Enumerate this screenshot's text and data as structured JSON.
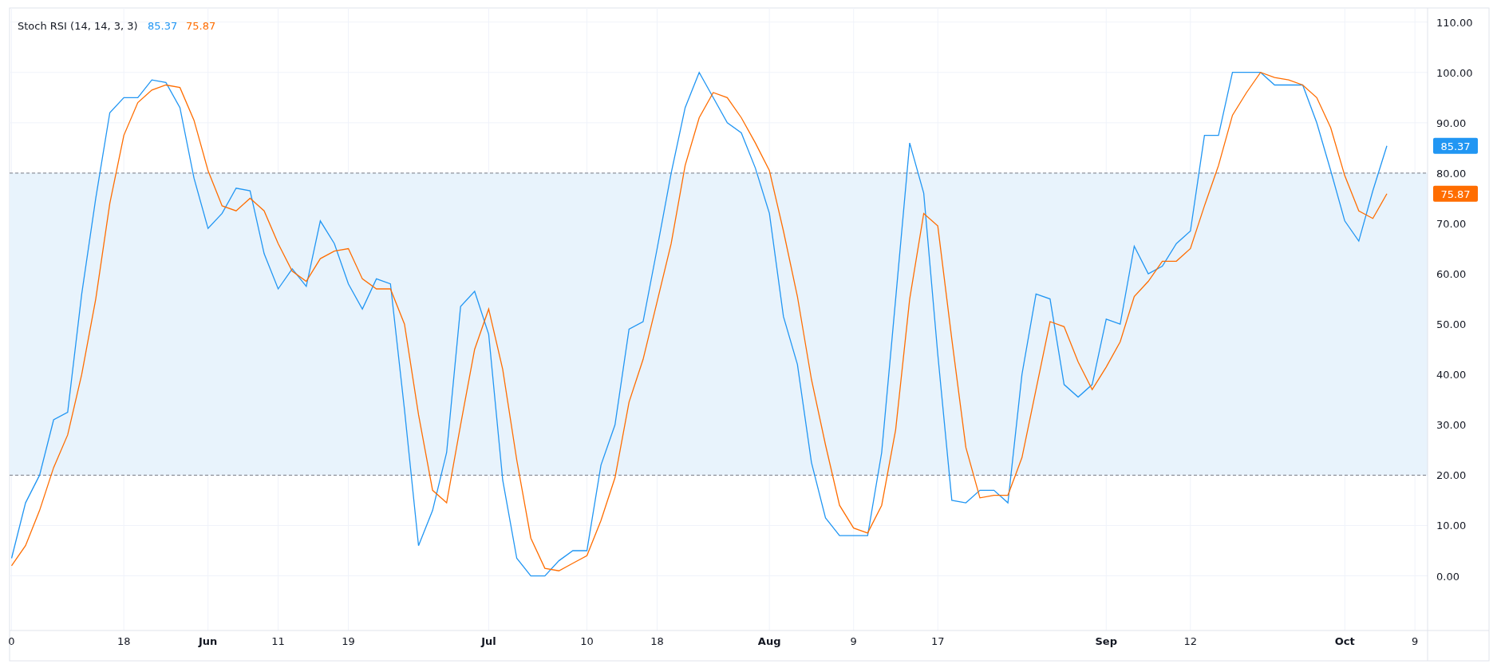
{
  "indicator": {
    "title": "Stoch RSI (14, 14, 3, 3)",
    "legend_values": [
      "85.37",
      "75.87"
    ],
    "axis_badges": [
      "85.37",
      "75.87"
    ],
    "x_label_bold": [
      false,
      false,
      true,
      false,
      false,
      true,
      false,
      false,
      true,
      false,
      false,
      true,
      false,
      true,
      false
    ],
    "chart_data": {
      "type": "line",
      "grid": true,
      "categories": [
        "0",
        null,
        null,
        null,
        null,
        null,
        null,
        null,
        "18",
        null,
        null,
        null,
        null,
        null,
        "Jun",
        null,
        null,
        null,
        null,
        "11",
        null,
        null,
        null,
        null,
        "19",
        null,
        null,
        null,
        null,
        null,
        null,
        null,
        null,
        null,
        "Jul",
        null,
        null,
        null,
        null,
        null,
        null,
        "10",
        null,
        null,
        null,
        null,
        "18",
        null,
        null,
        null,
        null,
        null,
        null,
        null,
        "Aug",
        null,
        null,
        null,
        null,
        null,
        "9",
        null,
        null,
        null,
        null,
        null,
        "17",
        null,
        null,
        null,
        null,
        null,
        null,
        null,
        null,
        null,
        null,
        null,
        "Sep",
        null,
        null,
        null,
        null,
        null,
        "12",
        null,
        null,
        null,
        null,
        null,
        null,
        null,
        null,
        null,
        null,
        "Oct",
        null,
        null,
        null,
        null,
        "9"
      ],
      "ylim": [
        -10.85,
        112.8
      ],
      "bands": [
        {
          "axis": "y",
          "from": 20,
          "to": 80
        }
      ],
      "series": [
        {
          "color": "#2196f3",
          "values": [
            3.5,
            14.5,
            20,
            31,
            32.5,
            56,
            75,
            92,
            95,
            95,
            98.5,
            98,
            93,
            79,
            69,
            72,
            77,
            76.5,
            64,
            57,
            61,
            57.5,
            70.5,
            66,
            58,
            53,
            59,
            58,
            33,
            6,
            13,
            24.5,
            53.5,
            56.5,
            48,
            19,
            3.5,
            0,
            0,
            3,
            5,
            5,
            22,
            30,
            49,
            50.5,
            65,
            80,
            93,
            100,
            95,
            90,
            88,
            81,
            72,
            51.5,
            42,
            22.5,
            11.5,
            8,
            8,
            8,
            24.5,
            55,
            86,
            76,
            44,
            15,
            14.5,
            17,
            17,
            14.5,
            40,
            56,
            55,
            38,
            35.5,
            38,
            51,
            50,
            65.5,
            60,
            61.5,
            66,
            68.5,
            87.5,
            87.5,
            100,
            100,
            100,
            97.5,
            97.5,
            97.5,
            90,
            80.5,
            70.5,
            66.5,
            76.5,
            85.4,
            null,
            null
          ]
        },
        {
          "color": "#ff6d00",
          "values": [
            2,
            6,
            13,
            21.5,
            28,
            40,
            55,
            74,
            87.5,
            94,
            96.5,
            97.5,
            97,
            90.5,
            80.5,
            73.5,
            72.5,
            75,
            72.5,
            66,
            60.5,
            58.5,
            63,
            64.5,
            65,
            59,
            57,
            57,
            50,
            32,
            17,
            14.5,
            30,
            45,
            53,
            41,
            23,
            7.5,
            1.5,
            1,
            2.5,
            4,
            11,
            19.5,
            34.5,
            43,
            54.5,
            66,
            81.5,
            91,
            96,
            95,
            91,
            86,
            80.5,
            68.5,
            55.5,
            39,
            26,
            14,
            9.5,
            8.5,
            14,
            29,
            55,
            72,
            69.5,
            47,
            25.5,
            15.5,
            16,
            16,
            23.5,
            37,
            50.5,
            49.5,
            42.5,
            37,
            41.5,
            46.5,
            55.5,
            58.5,
            62.5,
            62.5,
            65,
            73.5,
            81.5,
            91.5,
            96,
            100,
            99,
            98.5,
            97.5,
            95,
            89,
            79.5,
            72.5,
            71,
            75.9,
            null,
            null
          ]
        }
      ],
      "yticks": [
        {
          "value": 0,
          "label": "0.00"
        },
        {
          "value": 10,
          "label": "10.00"
        },
        {
          "value": 20,
          "label": "20.00"
        },
        {
          "value": 30,
          "label": "30.00"
        },
        {
          "value": 40,
          "label": "40.00"
        },
        {
          "value": 50,
          "label": "50.00"
        },
        {
          "value": 60,
          "label": "60.00"
        },
        {
          "value": 70,
          "label": "70.00"
        },
        {
          "value": 80,
          "label": "80.00"
        },
        {
          "value": 90,
          "label": "90.00"
        },
        {
          "value": 100,
          "label": "100.00"
        },
        {
          "value": 110,
          "label": "110.00"
        }
      ]
    }
  }
}
